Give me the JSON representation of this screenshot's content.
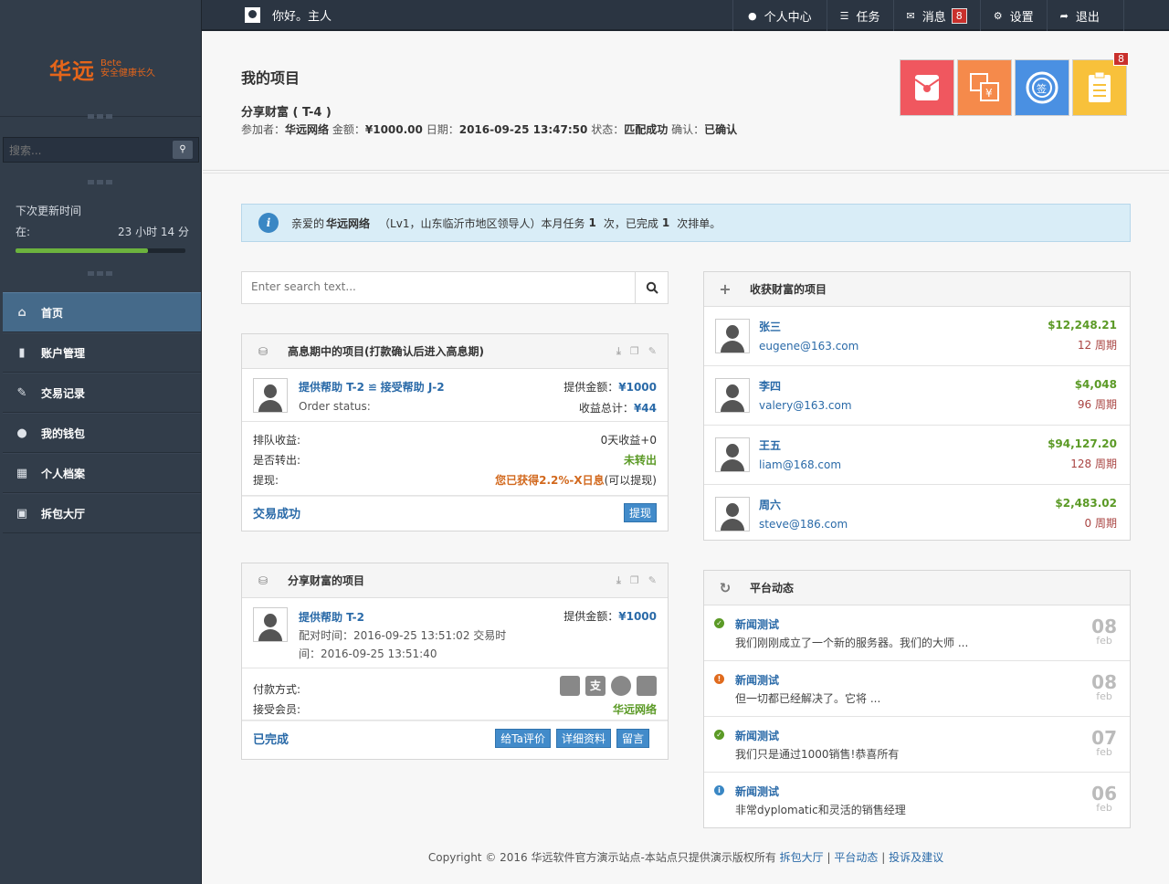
{
  "topbar": {
    "greeting": "你好。主人",
    "items": [
      {
        "label": "个人中心",
        "icon": "user-icon"
      },
      {
        "label": "任务",
        "icon": "list-icon"
      },
      {
        "label": "消息",
        "icon": "chat-icon",
        "badge": "8"
      },
      {
        "label": "设置",
        "icon": "gear-icon"
      },
      {
        "label": "退出",
        "icon": "share-icon"
      }
    ]
  },
  "sidebar": {
    "logo": "华远",
    "logo_sup": "Bete",
    "logo_tagline": "安全健康长久",
    "search_placeholder": "搜索...",
    "update_title": "下次更新时间",
    "update_at": "在:",
    "update_value": "23 小时 14 分",
    "update_progress": 0.78,
    "nav": [
      {
        "label": "首页",
        "icon": "home-icon",
        "active": true
      },
      {
        "label": "账户管理",
        "icon": "bar-chart-icon"
      },
      {
        "label": "交易记录",
        "icon": "pencil-icon"
      },
      {
        "label": "我的钱包",
        "icon": "user-icon"
      },
      {
        "label": "个人档案",
        "icon": "grid-icon"
      },
      {
        "label": "拆包大厅",
        "icon": "frame-icon"
      }
    ]
  },
  "header": {
    "title": "我的项目",
    "subtitle": "分享财富 ( T-4 )",
    "info_participant_label": "参加者：",
    "info_participant": "华远网络",
    "info_amount_label": "金额：",
    "info_amount": "¥1000.00",
    "info_date_label": "日期：",
    "info_date": "2016-09-25 13:47:50",
    "info_status_label": "状态：",
    "info_status": "匹配成功",
    "info_confirm_label": "确认：",
    "info_confirm": "已确认",
    "tile_badge": "8",
    "tile_icons": [
      "red-envelope-icon",
      "currency-exchange-icon",
      "sign-icon",
      "clipboard-list-icon"
    ]
  },
  "alert": {
    "greet": "亲爱的",
    "name": "华远网络",
    "desc": "（Lv1，山东临沂市地区领导人）本月任务",
    "count": "1",
    "mid": "次，已完成",
    "done": "1",
    "tail": "次排单。"
  },
  "search": {
    "placeholder": "Enter search text..."
  },
  "interest_panel": {
    "title": "高息期中的项目(打款确认后进入高息期)",
    "link_a": "提供帮助 T-2",
    "arrow": "≌",
    "link_b": "接受帮助 J-2",
    "order_label": "Order status:",
    "provide_label": "提供金额：",
    "provide_value": "¥1000",
    "profit_label": "收益总计：",
    "profit_value": "¥44",
    "rows": [
      {
        "label": "排队收益:",
        "value": "0天收益+0"
      },
      {
        "label": "是否转出:",
        "value": "未转出"
      },
      {
        "label": "提现:",
        "value": "您已获得2.2%-X日息",
        "extra": "(可以提现)"
      }
    ],
    "footer_status": "交易成功",
    "withdraw_btn": "提现"
  },
  "share_panel": {
    "title": "分享财富的项目",
    "link": "提供帮助 T-2",
    "provide_label": "提供金额：",
    "provide_value": "¥1000",
    "match_time": "配对时间：2016-09-25 13:51:02 交易时",
    "trade_time": "间：2016-09-25 13:51:40",
    "pay_label": "付款方式:",
    "member_label": "接受会员:",
    "member_value": "华远网络",
    "pay_icons": [
      "bank-card-icon",
      "alipay-icon",
      "wechat-icon",
      "tenpay-icon"
    ],
    "footer_status": "已完成",
    "buttons": [
      "给Ta评价",
      "详细资料",
      "留言"
    ]
  },
  "gain_panel": {
    "title": "收获财富的项目",
    "people": [
      {
        "name": "张三",
        "email": "eugene@163.com",
        "amount": "$12,248.21",
        "period": "12 周期"
      },
      {
        "name": "李四",
        "email": "valery@163.com",
        "amount": "$4,048",
        "period": "96 周期"
      },
      {
        "name": "王五",
        "email": "liam@168.com",
        "amount": "$94,127.20",
        "period": "128 周期"
      },
      {
        "name": "周六",
        "email": "steve@186.com",
        "amount": "$2,483.02",
        "period": "0 周期"
      }
    ]
  },
  "feed_panel": {
    "title": "平台动态",
    "items": [
      {
        "title": "新闻测试",
        "desc": "我们刚刚成立了一个新的服务器。我们的大师 ...",
        "day": "08",
        "month": "feb",
        "color": "#5b9a26",
        "icon": "check-icon"
      },
      {
        "title": "新闻测试",
        "desc": "但一切都已经解决了。它将 ...",
        "day": "08",
        "month": "feb",
        "color": "#e06b1e",
        "icon": "exclamation-icon"
      },
      {
        "title": "新闻测试",
        "desc": "我们只是通过1000销售!恭喜所有",
        "day": "07",
        "month": "feb",
        "color": "#5b9a26",
        "icon": "check-icon"
      },
      {
        "title": "新闻测试",
        "desc": "非常dyplomatic和灵活的销售经理",
        "day": "06",
        "month": "feb",
        "color": "#3a87c4",
        "icon": "info-icon"
      }
    ]
  },
  "footer": {
    "text": "Copyright © 2016 华远软件官方演示站点-本站点只提供演示版权所有",
    "links": [
      "拆包大厅",
      "平台动态",
      "投诉及建议"
    ],
    "sep": "|"
  }
}
